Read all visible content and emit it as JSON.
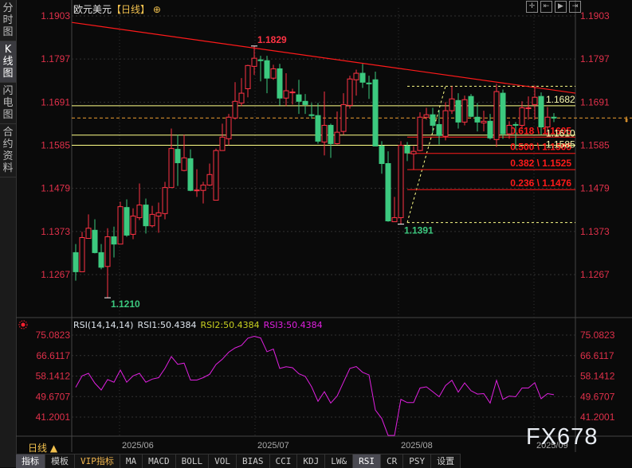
{
  "title": {
    "symbol": "欧元美元",
    "timeframe": "【日线】",
    "icon": "crosshair-circle-icon"
  },
  "sidebar": {
    "tabs": [
      {
        "label": "分时图",
        "active": false
      },
      {
        "label": "K线图",
        "active": true
      },
      {
        "label": "闪电图",
        "active": false
      },
      {
        "label": "合约资料",
        "active": false
      }
    ]
  },
  "toolbar_icons": [
    "crosshair-icon",
    "move-left-icon",
    "play-forward-icon",
    "move-right-icon"
  ],
  "colors": {
    "up": "#ff3344",
    "down": "#3cc97f",
    "rsi": "#e020e0",
    "trend": "#ff1a1a",
    "support": "#ffff88",
    "fib": "#ff1a1a",
    "last_price": "#f0a030",
    "axis_text": "#e0304a"
  },
  "chart_data": [
    {
      "type": "candlestick",
      "ylim": [
        1.121,
        1.1903
      ],
      "price_ticks": [
        "1.1903",
        "1.1797",
        "1.1691",
        "1.1585",
        "1.1479",
        "1.1373",
        "1.1267"
      ],
      "x_ticks": [
        "2025/06",
        "2025/07",
        "2025/08",
        "2025/09"
      ],
      "ohlc": [
        [
          1.1321,
          1.1342,
          1.1252,
          1.1274
        ],
        [
          1.1274,
          1.1372,
          1.1274,
          1.1358
        ],
        [
          1.1356,
          1.1415,
          1.1356,
          1.1381
        ],
        [
          1.1376,
          1.1403,
          1.1319,
          1.1321
        ],
        [
          1.1321,
          1.1342,
          1.128,
          1.1285
        ],
        [
          1.1287,
          1.1381,
          1.121,
          1.136
        ],
        [
          1.136,
          1.1385,
          1.1309,
          1.1342
        ],
        [
          1.1342,
          1.1446,
          1.1342,
          1.1434
        ],
        [
          1.1432,
          1.1452,
          1.136,
          1.1364
        ],
        [
          1.1366,
          1.143,
          1.1354,
          1.1411
        ],
        [
          1.1407,
          1.1491,
          1.1401,
          1.1438
        ],
        [
          1.1438,
          1.1454,
          1.1368,
          1.1387
        ],
        [
          1.1387,
          1.1436,
          1.1383,
          1.1415
        ],
        [
          1.1411,
          1.1444,
          1.137,
          1.1419
        ],
        [
          1.1417,
          1.1495,
          1.1403,
          1.1481
        ],
        [
          1.1481,
          1.1626,
          1.1481,
          1.1577
        ],
        [
          1.1575,
          1.1611,
          1.1485,
          1.1542
        ],
        [
          1.1523,
          1.1611,
          1.1521,
          1.1554
        ],
        [
          1.1552,
          1.1575,
          1.1472,
          1.1474
        ],
        [
          1.1474,
          1.1526,
          1.1458,
          1.1475
        ],
        [
          1.1474,
          1.1495,
          1.1442,
          1.1487
        ],
        [
          1.1487,
          1.154,
          1.1485,
          1.1513
        ],
        [
          1.145,
          1.1577,
          1.145,
          1.1572
        ],
        [
          1.1572,
          1.1638,
          1.1572,
          1.1605
        ],
        [
          1.1601,
          1.1662,
          1.1585,
          1.1654
        ],
        [
          1.1652,
          1.174,
          1.1648,
          1.1693
        ],
        [
          1.1689,
          1.175,
          1.1681,
          1.1713
        ],
        [
          1.1724,
          1.1783,
          1.1703,
          1.1781
        ],
        [
          1.1779,
          1.1829,
          1.1758,
          1.1799
        ],
        [
          1.1795,
          1.1805,
          1.1742,
          1.1794
        ],
        [
          1.1793,
          1.1805,
          1.1713,
          1.175
        ],
        [
          1.175,
          1.1783,
          1.1746,
          1.1773
        ],
        [
          1.1773,
          1.1785,
          1.1683,
          1.1701
        ],
        [
          1.1701,
          1.1762,
          1.1681,
          1.1719
        ],
        [
          1.1714,
          1.1724,
          1.1685,
          1.1716
        ],
        [
          1.1709,
          1.1746,
          1.1662,
          1.1693
        ],
        [
          1.1693,
          1.1711,
          1.1662,
          1.1685
        ],
        [
          1.166,
          1.1689,
          1.165,
          1.1659
        ],
        [
          1.1658,
          1.1689,
          1.1589,
          1.1595
        ],
        [
          1.1593,
          1.1717,
          1.156,
          1.1634
        ],
        [
          1.1634,
          1.1638,
          1.1554,
          1.1589
        ],
        [
          1.1589,
          1.1668,
          1.1587,
          1.1617
        ],
        [
          1.1619,
          1.1713,
          1.1611,
          1.1685
        ],
        [
          1.1683,
          1.1756,
          1.1675,
          1.1748
        ],
        [
          1.1746,
          1.1771,
          1.1707,
          1.1762
        ],
        [
          1.1762,
          1.1785,
          1.1726,
          1.174
        ],
        [
          1.1738,
          1.1756,
          1.1699,
          1.1736
        ],
        [
          1.1746,
          1.1766,
          1.1583,
          1.1583
        ],
        [
          1.1583,
          1.1595,
          1.1515,
          1.154
        ],
        [
          1.154,
          1.157,
          1.1397,
          1.1399
        ],
        [
          1.1397,
          1.1458,
          1.1397,
          1.1407
        ],
        [
          1.1407,
          1.1595,
          1.1391,
          1.1585
        ],
        [
          1.1583,
          1.1593,
          1.1546,
          1.1566
        ],
        [
          1.1564,
          1.1583,
          1.1525,
          1.157
        ],
        [
          1.1572,
          1.1666,
          1.157,
          1.1654
        ],
        [
          1.1654,
          1.1677,
          1.1648,
          1.166
        ],
        [
          1.166,
          1.1677,
          1.1615,
          1.1634
        ],
        [
          1.1636,
          1.1672,
          1.1587,
          1.1609
        ],
        [
          1.1607,
          1.1691,
          1.1597,
          1.167
        ],
        [
          1.167,
          1.173,
          1.1662,
          1.1699
        ],
        [
          1.1695,
          1.1713,
          1.1626,
          1.1642
        ],
        [
          1.1642,
          1.1707,
          1.1634,
          1.1697
        ],
        [
          1.1705,
          1.1711,
          1.1654,
          1.1656
        ],
        [
          1.1654,
          1.1689,
          1.1619,
          1.1642
        ],
        [
          1.164,
          1.167,
          1.1619,
          1.1644
        ],
        [
          1.1644,
          1.1662,
          1.1599,
          1.1603
        ],
        [
          1.1599,
          1.1736,
          1.1581,
          1.1717
        ],
        [
          1.1713,
          1.1722,
          1.1601,
          1.1613
        ],
        [
          1.1613,
          1.1644,
          1.1601,
          1.1634
        ],
        [
          1.1636,
          1.1642,
          1.1575,
          1.1634
        ],
        [
          1.1634,
          1.1693,
          1.1628,
          1.1677
        ],
        [
          1.1675,
          1.1705,
          1.1648,
          1.1677
        ],
        [
          1.1685,
          1.1732,
          1.1648,
          1.1703
        ],
        [
          1.1705,
          1.1715,
          1.1611,
          1.163
        ],
        [
          1.163,
          1.1679,
          1.1609,
          1.1654
        ],
        [
          1.1654,
          1.1664,
          1.1642,
          1.1652
        ]
      ],
      "annotations": [
        {
          "text": "1.1829",
          "bar": 28,
          "price": 1.1829,
          "color": "#ff3344",
          "pos": "above"
        },
        {
          "text": "1.1210",
          "bar": 5,
          "price": 1.121,
          "color": "#3cc97f",
          "pos": "below"
        },
        {
          "text": "1.1391",
          "bar": 51,
          "price": 1.1391,
          "color": "#3cc97f",
          "pos": "below"
        }
      ],
      "trendline": {
        "from": {
          "bar": -0.6,
          "price": 1.1887
        },
        "to": {
          "bar": 78.4,
          "price": 1.1713
        }
      },
      "support_lines": [
        {
          "price": 1.1682,
          "label": "1.1682"
        },
        {
          "price": 1.161,
          "label": "1.1610"
        },
        {
          "price": 1.1585,
          "label": "1.1585"
        }
      ],
      "last_price": 1.1652,
      "fibonacci": {
        "from_bar": 53,
        "high": 1.173,
        "low": 1.1395,
        "levels": [
          {
            "label": "0.618 \\ 1.1605",
            "price": 1.1605
          },
          {
            "label": "0.500 \\ 1.1565",
            "price": 1.1565
          },
          {
            "label": "0.382 \\ 1.1525",
            "price": 1.1525
          },
          {
            "label": "0.236 \\ 1.1476",
            "price": 1.1476
          }
        ]
      }
    },
    {
      "type": "line",
      "indicator": "RSI",
      "ylim": [
        33.3,
        75.0823
      ],
      "ticks": [
        "75.0823",
        "66.6117",
        "58.1412",
        "49.6707",
        "41.2001"
      ],
      "values": [
        53.5,
        58.2,
        59.3,
        55.2,
        52.4,
        56.7,
        55.6,
        60.6,
        55.6,
        58.2,
        59.3,
        55.6,
        56.9,
        57.5,
        61.3,
        66.2,
        63.0,
        63.5,
        56.5,
        56.5,
        57.5,
        58.9,
        62.9,
        65.1,
        68.0,
        69.8,
        70.8,
        73.8,
        74.6,
        73.9,
        68.2,
        69.3,
        61.3,
        62.0,
        61.6,
        59.1,
        58.0,
        53.7,
        47.7,
        51.7,
        47.0,
        49.9,
        55.6,
        61.3,
        62.1,
        59.7,
        58.6,
        44.1,
        40.6,
        33.6,
        33.6,
        48.5,
        47.2,
        47.2,
        53.2,
        53.7,
        51.7,
        49.6,
        54.2,
        56.4,
        51.5,
        55.3,
        52.1,
        50.7,
        50.9,
        47.0,
        56.4,
        48.5,
        49.9,
        49.6,
        53.2,
        53.2,
        55.4,
        48.8,
        50.9,
        50.44
      ]
    }
  ],
  "rsi_legend": {
    "params": "RSI(14,14,14)",
    "rsi1": "RSI1:50.4384",
    "rsi2": "RSI2:50.4384",
    "rsi3": "RSI3:50.4384",
    "rsi1_color": "#dfe6ee",
    "rsi2_color": "#c8d020",
    "rsi3_color": "#e020e0"
  },
  "period_selector": {
    "label": "日线",
    "icon": "triangle-up-icon"
  },
  "bottom_tabs": [
    {
      "label": "指标",
      "active": true
    },
    {
      "label": "模板"
    },
    {
      "label": "VIP指标",
      "vip": true
    },
    {
      "label": "MA"
    },
    {
      "label": "MACD"
    },
    {
      "label": "BOLL"
    },
    {
      "label": "VOL"
    },
    {
      "label": "BIAS"
    },
    {
      "label": "CCI"
    },
    {
      "label": "KDJ"
    },
    {
      "label": "LW&"
    },
    {
      "label": "RSI",
      "active": true
    },
    {
      "label": "CR"
    },
    {
      "label": "PSY"
    },
    {
      "label": "设置"
    }
  ],
  "watermark": "FX678"
}
